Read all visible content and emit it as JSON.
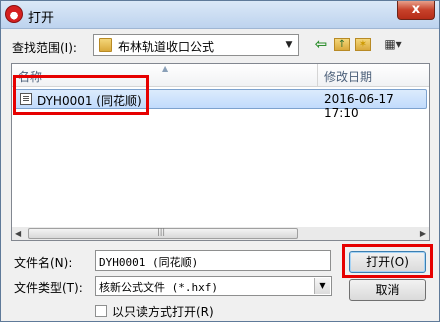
{
  "window": {
    "title": "打开",
    "close_label": "x"
  },
  "toolbar": {
    "look_in_label": "查找范围(I):",
    "look_in_value": "布林轨道收口公式",
    "icons": [
      "back-icon",
      "up-folder-icon",
      "new-folder-icon",
      "views-menu-icon"
    ]
  },
  "file_list": {
    "columns": [
      "名称",
      "修改日期"
    ],
    "rows": [
      {
        "name": "DYH0001 (同花顺)",
        "modified": "2016-06-17 17:10",
        "selected": true
      }
    ]
  },
  "form": {
    "file_name_label": "文件名(N):",
    "file_name_value": "DYH0001 (同花顺)",
    "file_type_label": "文件类型(T):",
    "file_type_value": "核新公式文件 (*.hxf)",
    "readonly_label": "以只读方式打开(R)",
    "readonly_checked": false
  },
  "buttons": {
    "open": "打开(O)",
    "cancel": "取消"
  },
  "colors": {
    "highlight": "#e60000",
    "selection": "#c1dbfc"
  }
}
